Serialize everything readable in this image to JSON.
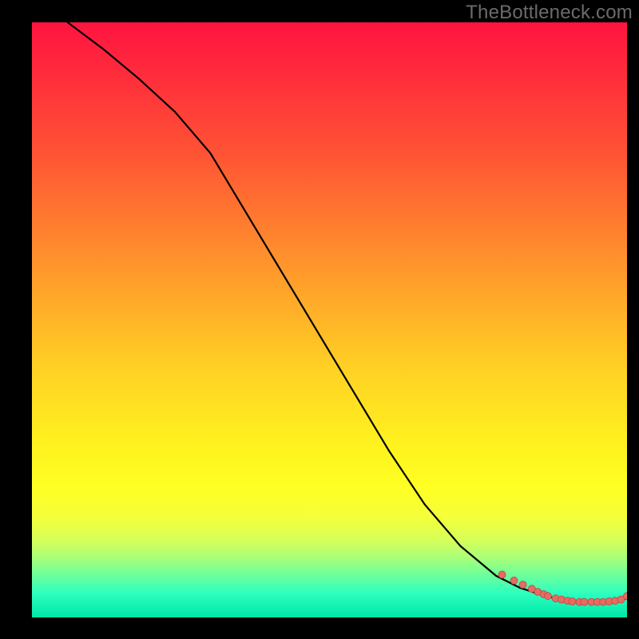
{
  "watermark": "TheBottleneck.com",
  "chart_data": {
    "type": "line",
    "title": "",
    "xlabel": "",
    "ylabel": "",
    "xlim": [
      0,
      100
    ],
    "ylim": [
      0,
      100
    ],
    "grid": false,
    "legend": false,
    "series": [
      {
        "name": "curve",
        "x": [
          6,
          12,
          18,
          24,
          30,
          36,
          42,
          48,
          54,
          60,
          66,
          72,
          78,
          82,
          85,
          88,
          91,
          94,
          96,
          98,
          100
        ],
        "y": [
          100,
          95.5,
          90.5,
          85,
          78,
          68,
          58,
          48,
          38,
          28,
          19,
          12,
          7,
          5,
          4,
          3.2,
          2.8,
          2.6,
          2.6,
          2.8,
          3.2
        ]
      }
    ],
    "dots": {
      "name": "scatter-markers",
      "x": [
        79,
        81,
        82.5,
        84,
        85,
        86,
        86.7,
        88,
        89,
        90,
        90.8,
        92,
        92.8,
        94,
        95,
        96,
        97,
        98,
        99,
        100
      ],
      "y": [
        7.2,
        6.2,
        5.5,
        4.8,
        4.3,
        3.9,
        3.6,
        3.2,
        3.0,
        2.8,
        2.7,
        2.6,
        2.6,
        2.6,
        2.6,
        2.6,
        2.7,
        2.8,
        3.0,
        3.6
      ]
    },
    "background_gradient": {
      "top": "#ff1440",
      "mid": "#ffff22",
      "bottom": "#00e6a8"
    }
  }
}
